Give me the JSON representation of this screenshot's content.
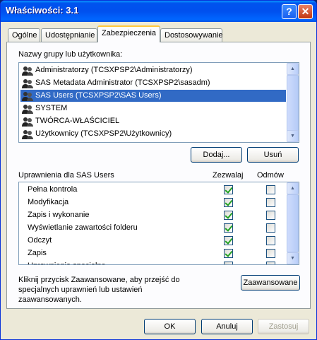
{
  "window": {
    "title": "Właściwości: 3.1",
    "help_icon": "?",
    "close_icon": "✕"
  },
  "tabs": [
    {
      "label": "Ogólne",
      "active": false
    },
    {
      "label": "Udostępnianie",
      "active": false
    },
    {
      "label": "Zabezpieczenia",
      "active": true
    },
    {
      "label": "Dostosowywanie",
      "active": false
    }
  ],
  "groups": {
    "label": "Nazwy grupy lub użytkownika:",
    "items": [
      {
        "name": "Administratorzy (TCSXPSP2\\Administratorzy)",
        "selected": false
      },
      {
        "name": "SAS Metadata Administrator (TCSXPSP2\\sasadm)",
        "selected": false
      },
      {
        "name": "SAS Users (TCSXPSP2\\SAS Users)",
        "selected": true
      },
      {
        "name": "SYSTEM",
        "selected": false
      },
      {
        "name": "TWÓRCA-WŁAŚCICIEL",
        "selected": false
      },
      {
        "name": "Użytkownicy (TCSXPSP2\\Użytkownicy)",
        "selected": false
      }
    ],
    "add_label": "Dodaj...",
    "remove_label": "Usuń"
  },
  "permissions": {
    "label": "Uprawnienia dla SAS Users",
    "allow_header": "Zezwalaj",
    "deny_header": "Odmów",
    "items": [
      {
        "name": "Pełna kontrola",
        "allow": true,
        "deny": false
      },
      {
        "name": "Modyfikacja",
        "allow": true,
        "deny": false
      },
      {
        "name": "Zapis i wykonanie",
        "allow": true,
        "deny": false
      },
      {
        "name": "Wyświetlanie zawartości folderu",
        "allow": true,
        "deny": false
      },
      {
        "name": "Odczyt",
        "allow": true,
        "deny": false
      },
      {
        "name": "Zapis",
        "allow": true,
        "deny": false
      },
      {
        "name": "Uprawnienia specjalne",
        "allow": false,
        "deny": false
      }
    ]
  },
  "advanced": {
    "note": "Kliknij przycisk Zaawansowane, aby przejść do specjalnych uprawnień lub ustawień zaawansowanych.",
    "button_label": "Zaawansowane"
  },
  "footer": {
    "ok_label": "OK",
    "cancel_label": "Anuluj",
    "apply_label": "Zastosuj"
  }
}
